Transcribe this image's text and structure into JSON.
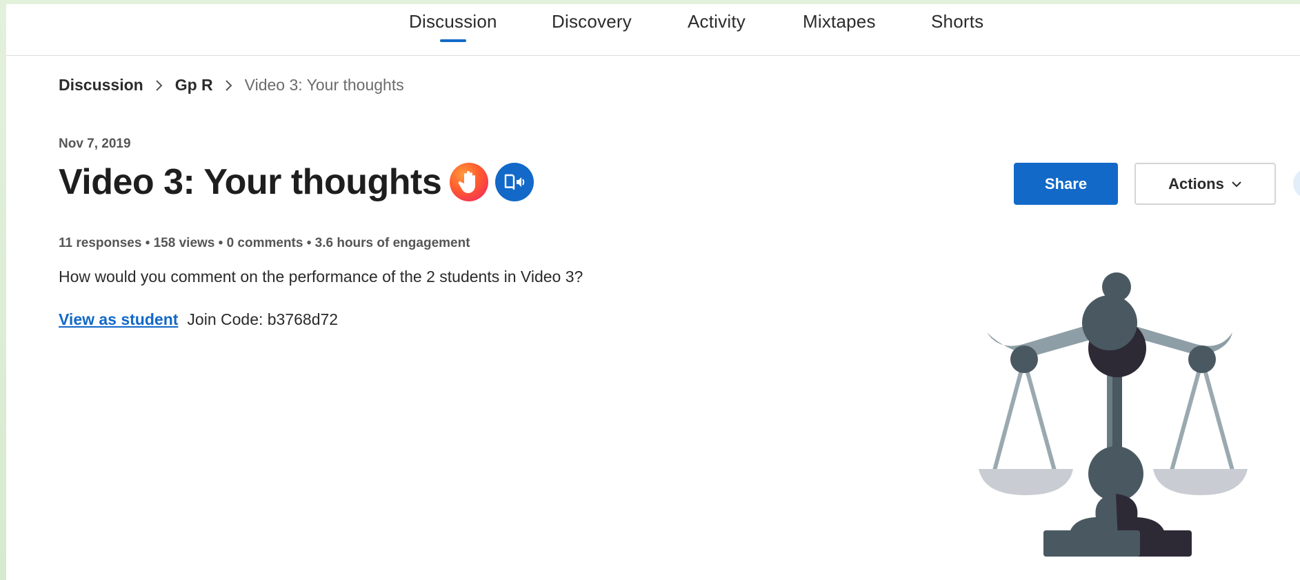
{
  "nav": {
    "tabs": [
      {
        "label": "Discussion",
        "active": true
      },
      {
        "label": "Discovery",
        "active": false
      },
      {
        "label": "Activity",
        "active": false
      },
      {
        "label": "Mixtapes",
        "active": false
      },
      {
        "label": "Shorts",
        "active": false
      }
    ]
  },
  "breadcrumb": {
    "items": [
      "Discussion",
      "Gp R"
    ],
    "current": "Video 3: Your thoughts"
  },
  "topic": {
    "date": "Nov 7, 2019",
    "title": "Video 3: Your thoughts",
    "stats": "11 responses • 158 views • 0 comments • 3.6 hours of engagement",
    "prompt": "How would you comment on the performance of the 2 students in Video 3?",
    "view_as_student": "View as student",
    "join_code": "Join Code: b3768d72"
  },
  "toolbar": {
    "share_label": "Share",
    "actions_label": "Actions"
  },
  "icons": {
    "badge_1": "raised-hand-icon",
    "badge_2": "immersive-reader-icon",
    "actions_chevron": "chevron-down-icon",
    "breadcrumb_separator": "chevron-right-icon",
    "illustration": "balance-scale-icon"
  },
  "colors": {
    "accent": "#1269c8",
    "background_frame": "#e3f1dc"
  }
}
